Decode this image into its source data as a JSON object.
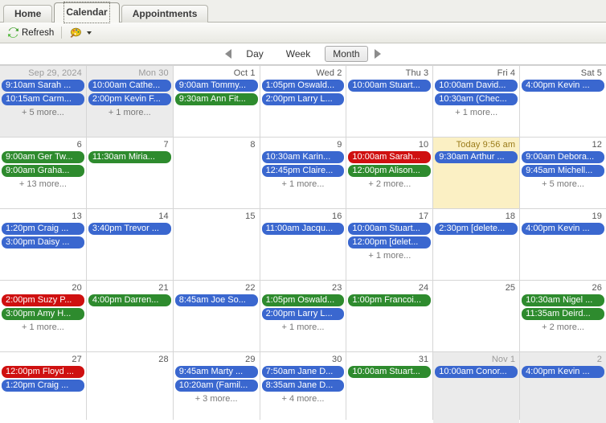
{
  "window": {
    "tabs": [
      {
        "label": "Home",
        "active": false
      },
      {
        "label": "Calendar",
        "active": true
      },
      {
        "label": "Appointments",
        "active": false
      }
    ]
  },
  "toolbar": {
    "refresh_label": "Refresh",
    "refresh_icon": "refresh-icon",
    "palette_icon": "palette-icon",
    "palette_caret": "chevron-down-icon"
  },
  "navigation": {
    "prev_icon": "triangle-left-icon",
    "next_icon": "triangle-right-icon",
    "views": [
      {
        "label": "Day",
        "selected": false
      },
      {
        "label": "Week",
        "selected": false
      },
      {
        "label": "Month",
        "selected": true
      }
    ]
  },
  "calendar": {
    "cells": [
      {
        "label": "Sep 29, 2024",
        "outside": true,
        "today": false,
        "events": [
          {
            "text": "9:10am Sarah ...",
            "color": "blue"
          },
          {
            "text": "10:15am Carm...",
            "color": "blue"
          }
        ],
        "more": "+ 5 more..."
      },
      {
        "label": "Mon 30",
        "outside": true,
        "today": false,
        "events": [
          {
            "text": "10:00am Cathe...",
            "color": "blue"
          },
          {
            "text": "2:00pm Kevin F...",
            "color": "blue"
          }
        ],
        "more": "+ 1 more..."
      },
      {
        "label": "Oct 1",
        "outside": false,
        "today": false,
        "events": [
          {
            "text": "9:00am Tommy...",
            "color": "blue"
          },
          {
            "text": "9:30am Ann Fit...",
            "color": "green"
          }
        ],
        "more": ""
      },
      {
        "label": "Wed 2",
        "outside": false,
        "today": false,
        "events": [
          {
            "text": "1:05pm Oswald...",
            "color": "blue"
          },
          {
            "text": "2:00pm Larry L...",
            "color": "blue"
          }
        ],
        "more": ""
      },
      {
        "label": "Thu 3",
        "outside": false,
        "today": false,
        "events": [
          {
            "text": "10:00am Stuart...",
            "color": "blue"
          }
        ],
        "more": ""
      },
      {
        "label": "Fri 4",
        "outside": false,
        "today": false,
        "events": [
          {
            "text": "10:00am David...",
            "color": "blue"
          },
          {
            "text": "10:30am (Chec...",
            "color": "blue"
          }
        ],
        "more": "+ 1 more..."
      },
      {
        "label": "Sat 5",
        "outside": false,
        "today": false,
        "events": [
          {
            "text": "4:00pm Kevin ...",
            "color": "blue"
          }
        ],
        "more": ""
      },
      {
        "label": "6",
        "outside": false,
        "today": false,
        "events": [
          {
            "text": "9:00am Ger Tw...",
            "color": "green"
          },
          {
            "text": "9:00am Graha...",
            "color": "green"
          }
        ],
        "more": "+ 13 more..."
      },
      {
        "label": "7",
        "outside": false,
        "today": false,
        "events": [
          {
            "text": "11:30am Miria...",
            "color": "green"
          }
        ],
        "more": ""
      },
      {
        "label": "8",
        "outside": false,
        "today": false,
        "events": [],
        "more": ""
      },
      {
        "label": "9",
        "outside": false,
        "today": false,
        "events": [
          {
            "text": "10:30am Karin...",
            "color": "blue"
          },
          {
            "text": "12:45pm Claire...",
            "color": "blue"
          }
        ],
        "more": "+ 1 more..."
      },
      {
        "label": "10",
        "outside": false,
        "today": false,
        "events": [
          {
            "text": "10:00am Sarah...",
            "color": "red"
          },
          {
            "text": "12:00pm Alison...",
            "color": "green"
          }
        ],
        "more": "+ 2 more..."
      },
      {
        "label": "Today 9:56 am",
        "outside": false,
        "today": true,
        "events": [
          {
            "text": "9:30am Arthur ...",
            "color": "blue"
          }
        ],
        "more": ""
      },
      {
        "label": "12",
        "outside": false,
        "today": false,
        "events": [
          {
            "text": "9:00am Debora...",
            "color": "blue"
          },
          {
            "text": "9:45am Michell...",
            "color": "blue"
          }
        ],
        "more": "+ 5 more..."
      },
      {
        "label": "13",
        "outside": false,
        "today": false,
        "events": [
          {
            "text": "1:20pm Craig ...",
            "color": "blue"
          },
          {
            "text": "3:00pm Daisy ...",
            "color": "blue"
          }
        ],
        "more": ""
      },
      {
        "label": "14",
        "outside": false,
        "today": false,
        "events": [
          {
            "text": "3:40pm Trevor ...",
            "color": "blue"
          }
        ],
        "more": ""
      },
      {
        "label": "15",
        "outside": false,
        "today": false,
        "events": [],
        "more": ""
      },
      {
        "label": "16",
        "outside": false,
        "today": false,
        "events": [
          {
            "text": "11:00am Jacqu...",
            "color": "blue"
          }
        ],
        "more": ""
      },
      {
        "label": "17",
        "outside": false,
        "today": false,
        "events": [
          {
            "text": "10:00am Stuart...",
            "color": "blue"
          },
          {
            "text": "12:00pm [delet...",
            "color": "blue"
          }
        ],
        "more": "+ 1 more..."
      },
      {
        "label": "18",
        "outside": false,
        "today": false,
        "events": [
          {
            "text": "2:30pm [delete...",
            "color": "blue"
          }
        ],
        "more": ""
      },
      {
        "label": "19",
        "outside": false,
        "today": false,
        "events": [
          {
            "text": "4:00pm Kevin ...",
            "color": "blue"
          }
        ],
        "more": ""
      },
      {
        "label": "20",
        "outside": false,
        "today": false,
        "events": [
          {
            "text": "2:00pm Suzy P...",
            "color": "red"
          },
          {
            "text": "3:00pm Amy H...",
            "color": "green"
          }
        ],
        "more": "+ 1 more..."
      },
      {
        "label": "21",
        "outside": false,
        "today": false,
        "events": [
          {
            "text": "4:00pm Darren...",
            "color": "green"
          }
        ],
        "more": ""
      },
      {
        "label": "22",
        "outside": false,
        "today": false,
        "events": [
          {
            "text": "8:45am Joe So...",
            "color": "blue"
          }
        ],
        "more": ""
      },
      {
        "label": "23",
        "outside": false,
        "today": false,
        "events": [
          {
            "text": "1:05pm Oswald...",
            "color": "green"
          },
          {
            "text": "2:00pm Larry L...",
            "color": "blue"
          }
        ],
        "more": "+ 1 more..."
      },
      {
        "label": "24",
        "outside": false,
        "today": false,
        "events": [
          {
            "text": "1:00pm Francoi...",
            "color": "green"
          }
        ],
        "more": ""
      },
      {
        "label": "25",
        "outside": false,
        "today": false,
        "events": [],
        "more": ""
      },
      {
        "label": "26",
        "outside": false,
        "today": false,
        "events": [
          {
            "text": "10:30am Nigel ...",
            "color": "green"
          },
          {
            "text": "11:35am Deird...",
            "color": "green"
          }
        ],
        "more": "+ 2 more..."
      },
      {
        "label": "27",
        "outside": false,
        "today": false,
        "events": [
          {
            "text": "12:00pm Floyd ...",
            "color": "red"
          },
          {
            "text": "1:20pm Craig ...",
            "color": "blue"
          }
        ],
        "more": ""
      },
      {
        "label": "28",
        "outside": false,
        "today": false,
        "events": [],
        "more": ""
      },
      {
        "label": "29",
        "outside": false,
        "today": false,
        "events": [
          {
            "text": "9:45am Marty ...",
            "color": "blue"
          },
          {
            "text": "10:20am (Famil...",
            "color": "blue"
          }
        ],
        "more": "+ 3 more..."
      },
      {
        "label": "30",
        "outside": false,
        "today": false,
        "events": [
          {
            "text": "7:50am Jane D...",
            "color": "blue"
          },
          {
            "text": "8:35am Jane D...",
            "color": "blue"
          }
        ],
        "more": "+ 4 more..."
      },
      {
        "label": "31",
        "outside": false,
        "today": false,
        "events": [
          {
            "text": "10:00am Stuart...",
            "color": "green"
          }
        ],
        "more": ""
      },
      {
        "label": "Nov 1",
        "outside": true,
        "today": false,
        "events": [
          {
            "text": "10:00am Conor...",
            "color": "blue"
          }
        ],
        "more": ""
      },
      {
        "label": "2",
        "outside": true,
        "today": false,
        "events": [
          {
            "text": "4:00pm Kevin ...",
            "color": "blue"
          }
        ],
        "more": ""
      }
    ]
  },
  "colors": {
    "event_blue": "#3a67cf",
    "event_green": "#2e8b2e",
    "event_red": "#cf1010",
    "today_bg": "#fbf0c4",
    "outside_bg": "#ebebeb"
  }
}
